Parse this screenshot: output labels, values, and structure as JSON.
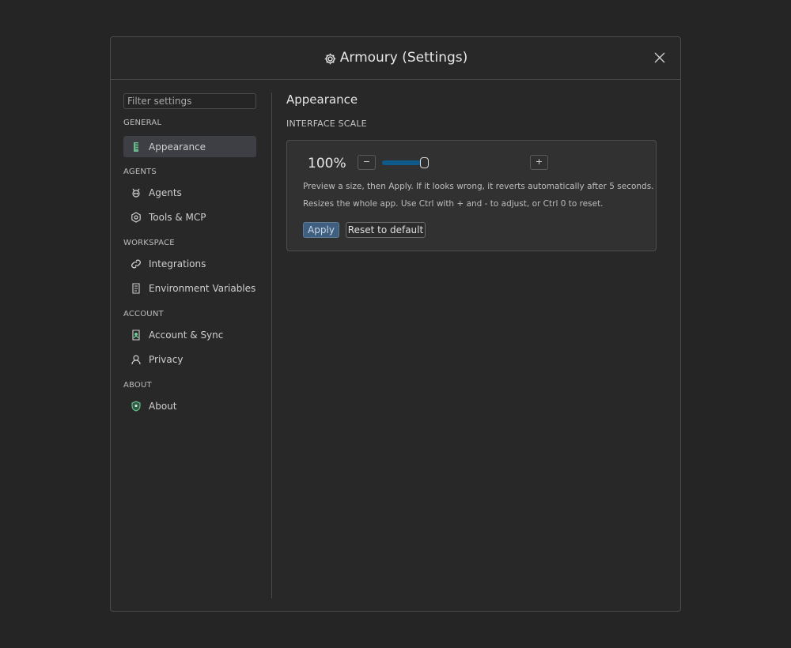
{
  "window": {
    "title": "Armoury (Settings)"
  },
  "sidebar": {
    "filter_placeholder": "Filter settings",
    "sections": [
      {
        "label": "GENERAL",
        "items": [
          {
            "label": "Appearance",
            "icon": "appearance-icon",
            "active": true
          }
        ]
      },
      {
        "label": "AGENTS",
        "items": [
          {
            "label": "Agents",
            "icon": "agents-icon",
            "active": false
          },
          {
            "label": "Tools & MCP",
            "icon": "tools-icon",
            "active": false
          }
        ]
      },
      {
        "label": "WORKSPACE",
        "items": [
          {
            "label": "Integrations",
            "icon": "link-icon",
            "active": false
          },
          {
            "label": "Environment Variables",
            "icon": "env-vars-icon",
            "active": false
          }
        ]
      },
      {
        "label": "ACCOUNT",
        "items": [
          {
            "label": "Account & Sync",
            "icon": "account-sync-icon",
            "active": false
          },
          {
            "label": "Privacy",
            "icon": "privacy-icon",
            "active": false
          }
        ]
      },
      {
        "label": "ABOUT",
        "items": [
          {
            "label": "About",
            "icon": "about-icon",
            "active": false
          }
        ]
      }
    ]
  },
  "main": {
    "title": "Appearance",
    "section_label": "INTERFACE SCALE",
    "scale": {
      "value_text": "100%",
      "decrease_label": "−",
      "increase_label": "+",
      "slider_fraction": 0.23
    },
    "help_line_1": "Preview a size, then Apply. If it looks wrong, it reverts automatically after 5 seconds.",
    "help_line_2": "Resizes the whole app. Use Ctrl with + and - to adjust, or Ctrl 0 to reset.",
    "apply_label": "Apply",
    "reset_label": "Reset to default"
  },
  "colors": {
    "background": "#252525",
    "accent": "#0f5a8a",
    "apply_button": "#3f5f80",
    "active_nav": "#3d3f44",
    "icon_green": "#6fcf97"
  }
}
